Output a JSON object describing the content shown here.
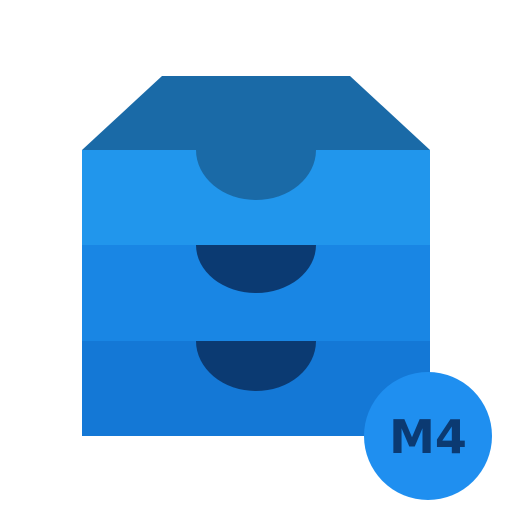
{
  "icon": {
    "name": "drawer-cabinet-icon",
    "colors": {
      "top": "#1a6aa7",
      "drawer_top": "#2196ec",
      "drawer_middle": "#1986e4",
      "drawer_bottom": "#1478d6",
      "handle_top": "#1a6aa7",
      "handle_lower": "#0b3a72"
    }
  },
  "badge": {
    "label": "M4",
    "color": "#1f8ff0",
    "text_color": "#0b3a72"
  }
}
